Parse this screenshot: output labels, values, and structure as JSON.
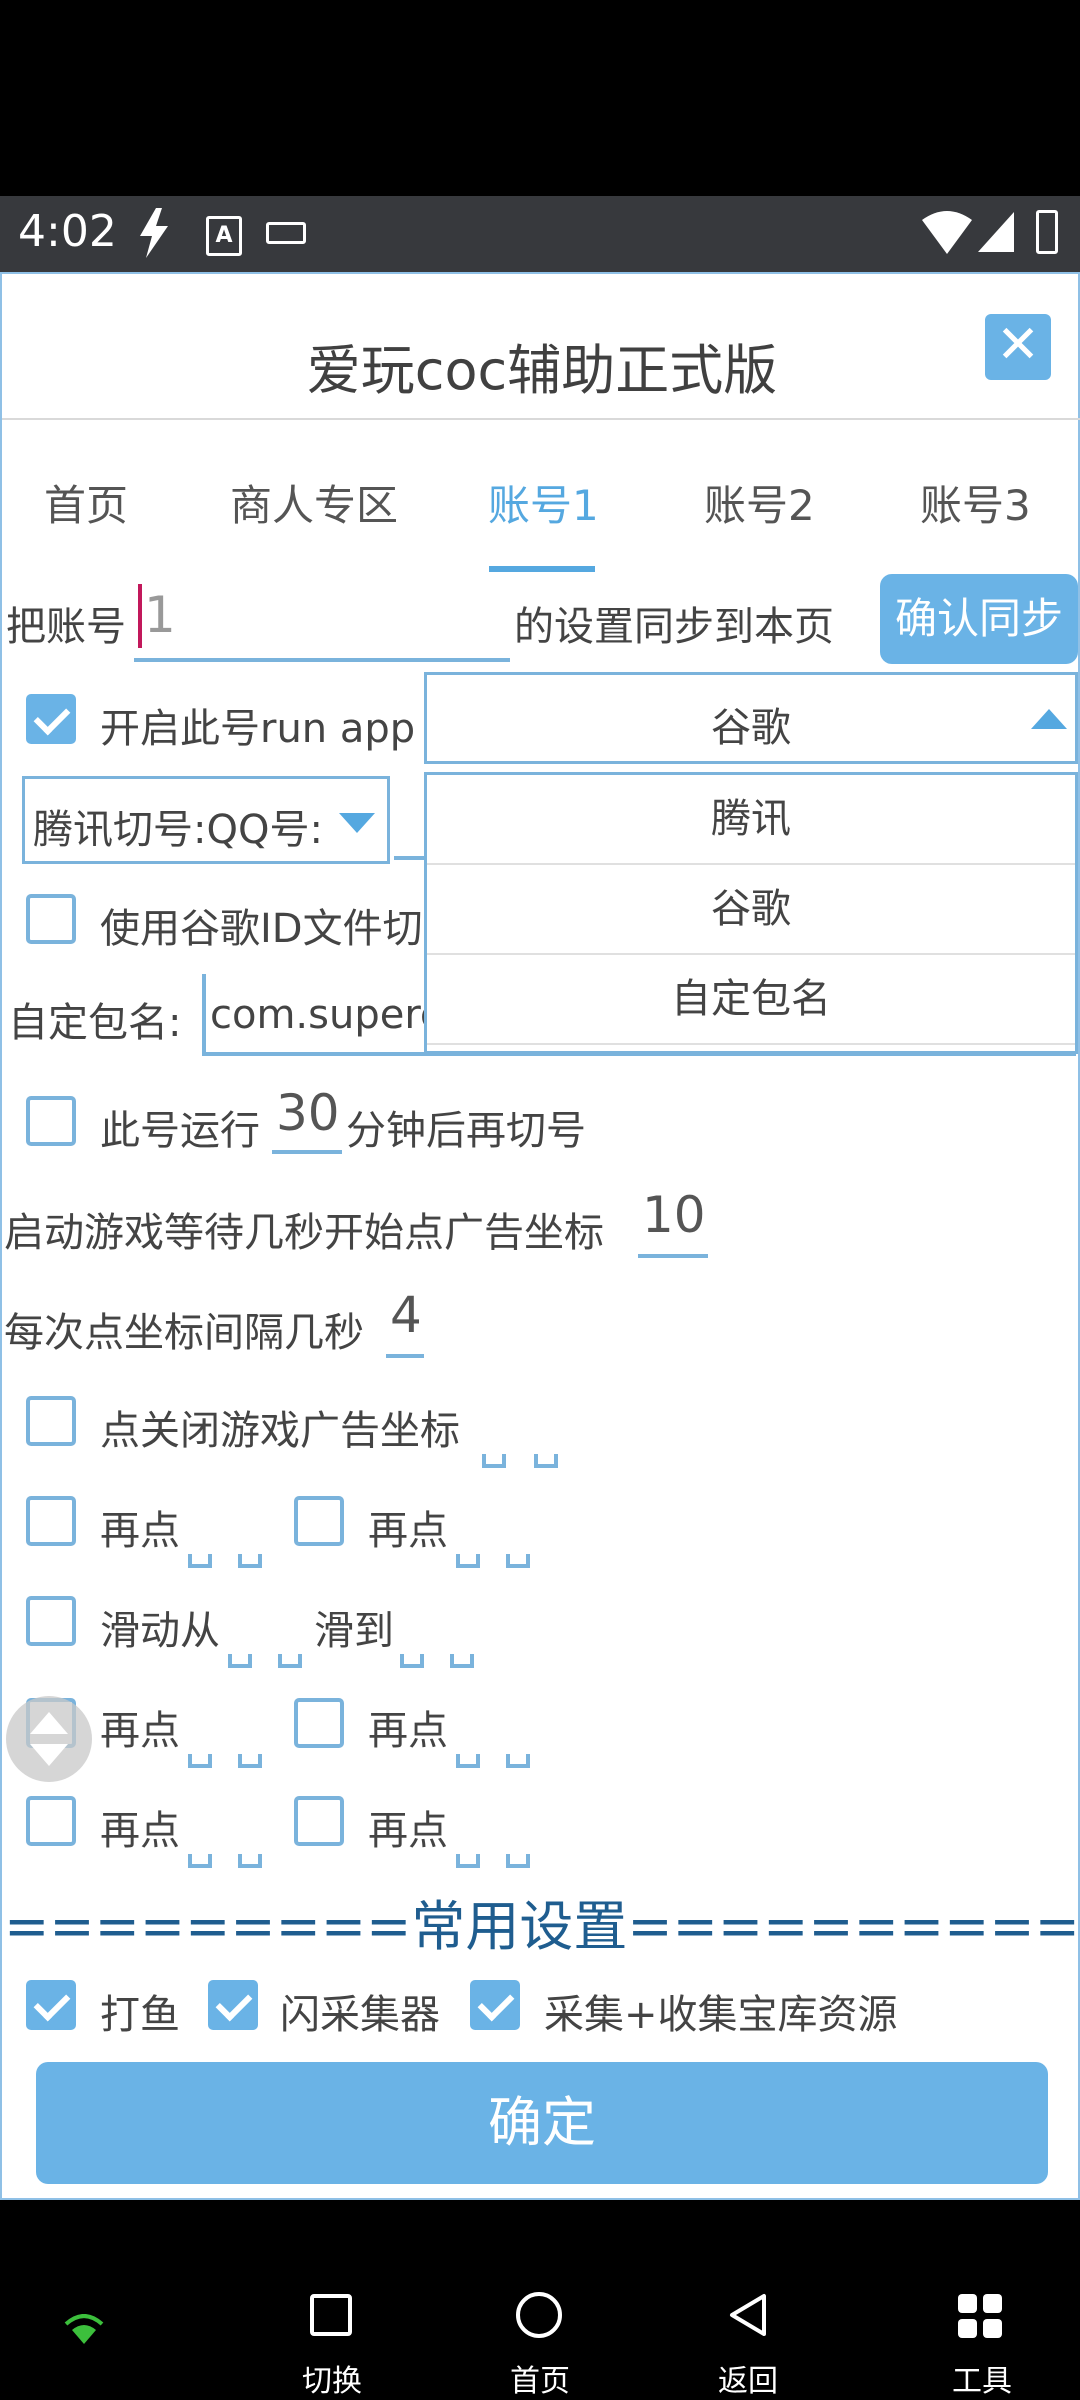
{
  "status_bar": {
    "time": "4:02"
  },
  "app": {
    "title": "爱玩coc辅助正式版",
    "tabs": [
      "首页",
      "商人专区",
      "账号1",
      "账号2",
      "账号3"
    ],
    "active_tab": "账号1",
    "sync": {
      "prefix": "把账号",
      "value": "1",
      "suffix": "的设置同步到本页",
      "button": "确认同步"
    },
    "run_app": {
      "label": "开启此号run app",
      "checked": true
    },
    "dropdown": {
      "selected": "谷歌",
      "options": [
        "腾讯",
        "谷歌",
        "自定包名"
      ]
    },
    "spinner": {
      "value": "腾讯切号:QQ号:"
    },
    "google_id_label": "使用谷歌ID文件切",
    "package": {
      "label": "自定包名:",
      "value": "com.superc"
    },
    "run_minutes": {
      "prefix": "此号运行",
      "value": "30",
      "suffix": "分钟后再切号"
    },
    "wait_seconds": {
      "label": "启动游戏等待几秒开始点广告坐标",
      "value": "10"
    },
    "interval": {
      "label": "每次点坐标间隔几秒",
      "value": "4"
    },
    "close_ad_label": "点关闭游戏广告坐标",
    "click_again": "再点",
    "slide_from": "滑动从",
    "slide_to": "滑到",
    "section_title": "=========常用设置==========",
    "common": [
      "打鱼",
      "闪采集器",
      "采集+收集宝库资源"
    ],
    "confirm": "确定"
  },
  "nav": {
    "switch": "切换",
    "home": "首页",
    "back": "返回",
    "tools": "工具"
  },
  "colors": {
    "accent": "#6ab3e6",
    "active_tab": "#55a8e0",
    "section": "#1f5d8f"
  }
}
